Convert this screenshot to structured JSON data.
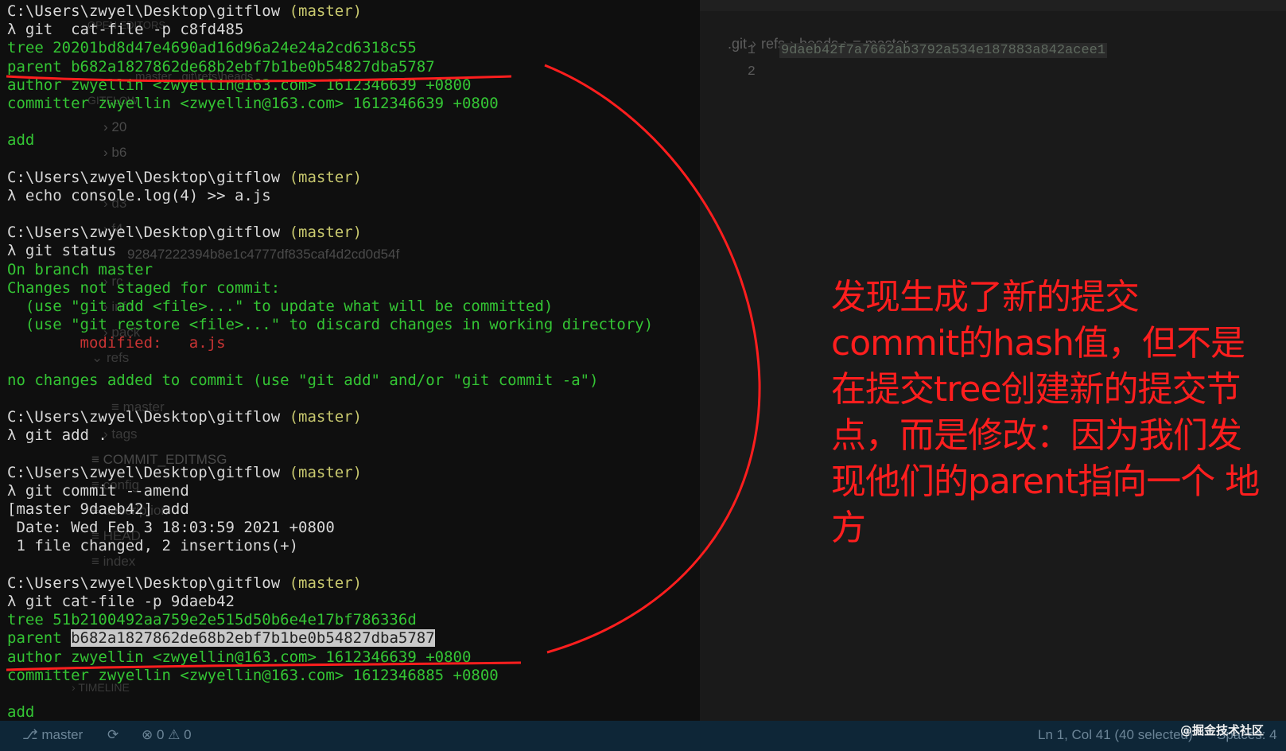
{
  "editor": {
    "breadcrumb": [
      ".git",
      "refs",
      "heads",
      "master"
    ],
    "line_numbers": [
      "1",
      "2"
    ],
    "line1_text": "9daeb42f7a7662ab3792a534e187883a842acee1",
    "sidebar_ghost": [
      "OPEN EDITORS",
      "master  .git\\refs\\heads",
      "GITFLOW",
      "20",
      "b6",
      "d3",
      "f4",
      "92847222394b8e1c4777df835caf4d2cd0d54f",
      "rc",
      "info",
      "pack",
      "refs",
      "master",
      "tags",
      "COMMIT_EDITMSG",
      "config",
      "description",
      "HEAD",
      "index",
      "TIMELINE"
    ]
  },
  "terminal": [
    [
      {
        "t": "C:\\Users\\zwyel\\Desktop\\gitflow",
        "c": "white"
      },
      {
        "t": " (master)",
        "c": "yellow"
      }
    ],
    [
      {
        "t": "λ git  cat-file -p c8fd485",
        "c": "white"
      }
    ],
    [
      {
        "t": "tree 20201bd8d47e4690ad16d96a24e24a2cd6318c55",
        "c": "green"
      }
    ],
    [
      {
        "t": "parent b682a1827862de68b2ebf7b1be0b54827dba5787",
        "c": "green"
      }
    ],
    [
      {
        "t": "author zwyellin <zwyellin@163.com> 1612346639 +0800",
        "c": "green"
      }
    ],
    [
      {
        "t": "committer zwyellin <zwyellin@163.com> 1612346639 +0800",
        "c": "green"
      }
    ],
    [
      {
        "t": "",
        "c": "green"
      }
    ],
    [
      {
        "t": "add",
        "c": "green"
      }
    ],
    [
      {
        "t": "",
        "c": "green"
      }
    ],
    [
      {
        "t": "C:\\Users\\zwyel\\Desktop\\gitflow",
        "c": "white"
      },
      {
        "t": " (master)",
        "c": "yellow"
      }
    ],
    [
      {
        "t": "λ echo console.log(4) >> a.js",
        "c": "white"
      }
    ],
    [
      {
        "t": "",
        "c": "green"
      }
    ],
    [
      {
        "t": "C:\\Users\\zwyel\\Desktop\\gitflow",
        "c": "white"
      },
      {
        "t": " (master)",
        "c": "yellow"
      }
    ],
    [
      {
        "t": "λ git status",
        "c": "white"
      }
    ],
    [
      {
        "t": "On branch master",
        "c": "green"
      }
    ],
    [
      {
        "t": "Changes not staged for commit:",
        "c": "green"
      }
    ],
    [
      {
        "t": "  (use \"git add <file>...\" to update what will be committed)",
        "c": "green"
      }
    ],
    [
      {
        "t": "  (use \"git restore <file>...\" to discard changes in working directory)",
        "c": "green"
      }
    ],
    [
      {
        "t": "        modified:   a.js",
        "c": "red"
      }
    ],
    [
      {
        "t": "",
        "c": "green"
      }
    ],
    [
      {
        "t": "no changes added to commit (use \"git add\" and/or \"git commit -a\")",
        "c": "green"
      }
    ],
    [
      {
        "t": "",
        "c": "green"
      }
    ],
    [
      {
        "t": "C:\\Users\\zwyel\\Desktop\\gitflow",
        "c": "white"
      },
      {
        "t": " (master)",
        "c": "yellow"
      }
    ],
    [
      {
        "t": "λ git add .",
        "c": "white"
      }
    ],
    [
      {
        "t": "",
        "c": "green"
      }
    ],
    [
      {
        "t": "C:\\Users\\zwyel\\Desktop\\gitflow",
        "c": "white"
      },
      {
        "t": " (master)",
        "c": "yellow"
      }
    ],
    [
      {
        "t": "λ git commit --amend",
        "c": "white"
      }
    ],
    [
      {
        "t": "[master 9daeb42] add",
        "c": "white"
      }
    ],
    [
      {
        "t": " Date: Wed Feb 3 18:03:59 2021 +0800",
        "c": "white"
      }
    ],
    [
      {
        "t": " 1 file changed, 2 insertions(+)",
        "c": "white"
      }
    ],
    [
      {
        "t": "",
        "c": "green"
      }
    ],
    [
      {
        "t": "C:\\Users\\zwyel\\Desktop\\gitflow",
        "c": "white"
      },
      {
        "t": " (master)",
        "c": "yellow"
      }
    ],
    [
      {
        "t": "λ git cat-file -p 9daeb42",
        "c": "white"
      }
    ],
    [
      {
        "t": "tree 51b2100492aa759e2e515d50b6e4e17bf786336d",
        "c": "green"
      }
    ],
    [
      {
        "t": "parent ",
        "c": "green"
      },
      {
        "t": "b682a1827862de68b2ebf7b1be0b54827dba5787",
        "c": "hl"
      }
    ],
    [
      {
        "t": "author zwyellin <zwyellin@163.com> 1612346639 +0800",
        "c": "green"
      }
    ],
    [
      {
        "t": "committer zwyellin <zwyellin@163.com> 1612346885 +0800",
        "c": "green"
      }
    ],
    [
      {
        "t": "",
        "c": "green"
      }
    ],
    [
      {
        "t": "add",
        "c": "green"
      }
    ]
  ],
  "annotation": "发现生成了新的提交commit的hash值，但不是在提交tree创建新的提交节点，而是修改：因为我们发现他们的parent指向一个 地方",
  "statusbar": {
    "branch": "master",
    "sync": "⟳",
    "errors": "0",
    "warnings": "0",
    "position": "Ln 1, Col 41 (40 selected)",
    "spaces": "Spaces: 4"
  },
  "watermark": "@掘金技术社区",
  "colors": {
    "terminal_green": "#34c534",
    "terminal_white": "#d8d8d8",
    "terminal_yellow": "#c8c86e",
    "terminal_red": "#c83434",
    "annotation_red": "#ff1e1e",
    "statusbar_bg": "#0e2637"
  }
}
